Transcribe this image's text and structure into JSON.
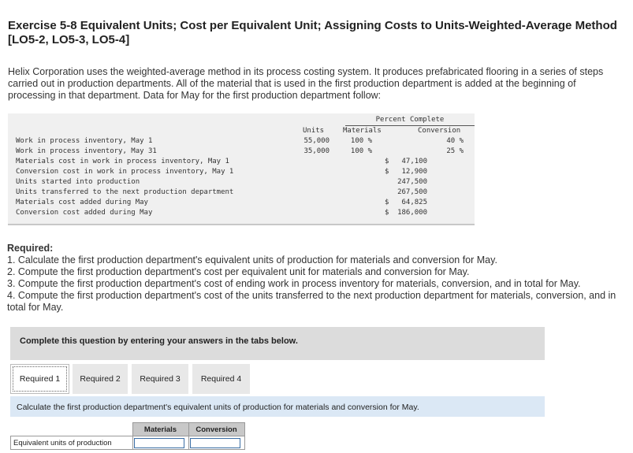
{
  "title": "Exercise 5-8 Equivalent Units; Cost per Equivalent Unit; Assigning Costs to Units-Weighted-Average Method [LO5-2, LO5-3, LO5-4]",
  "intro": "Helix Corporation uses the weighted-average method in its process costing system. It produces prefabricated flooring in a series of steps carried out in production departments. All of the material that is used in the first production department is added at the beginning of processing in that department. Data for May for the first production department follow:",
  "data_table": {
    "percent_complete_header": "Percent Complete",
    "col_units": "Units",
    "col_materials": "Materials",
    "col_conversion": "Conversion",
    "rows": [
      {
        "label": "Work in process inventory, May 1",
        "units": "55,000",
        "materials": "100 %",
        "conversion": "40 %"
      },
      {
        "label": "Work in process inventory, May 31",
        "units": "35,000",
        "materials": "100 %",
        "conversion": "25 %"
      },
      {
        "label": "Materials cost in work in process inventory, May 1",
        "dollar": "$",
        "amount": "47,100"
      },
      {
        "label": "Conversion cost in work in process inventory, May 1",
        "dollar": "$",
        "amount": "12,900"
      },
      {
        "label": "Units started into production",
        "amount": "247,500"
      },
      {
        "label": "Units transferred to the next production department",
        "amount": "267,500"
      },
      {
        "label": "Materials cost added during May",
        "dollar": "$",
        "amount": "64,825"
      },
      {
        "label": "Conversion cost added during May",
        "dollar": "$",
        "amount": "186,000"
      }
    ]
  },
  "required": {
    "heading": "Required:",
    "items": [
      "1. Calculate the first production department's equivalent units of production for materials and conversion for May.",
      "2. Compute the first production department's cost per equivalent unit for materials and conversion for May.",
      "3. Compute the first production department's cost of ending work in process inventory for materials, conversion, and in total for May.",
      "4. Compute the first production department's cost of the units transferred to the next production department for materials, conversion, and in total for May."
    ]
  },
  "complete_prompt": "Complete this question by entering your answers in the tabs below.",
  "tabs": [
    {
      "label": "Required 1",
      "active": true
    },
    {
      "label": "Required 2",
      "active": false
    },
    {
      "label": "Required 3",
      "active": false
    },
    {
      "label": "Required 4",
      "active": false
    }
  ],
  "instruction": "Calculate the first production department's equivalent units of production for materials and conversion for May.",
  "answer_table": {
    "col_materials": "Materials",
    "col_conversion": "Conversion",
    "row_label": "Equivalent units of production",
    "materials_value": "",
    "conversion_value": ""
  }
}
